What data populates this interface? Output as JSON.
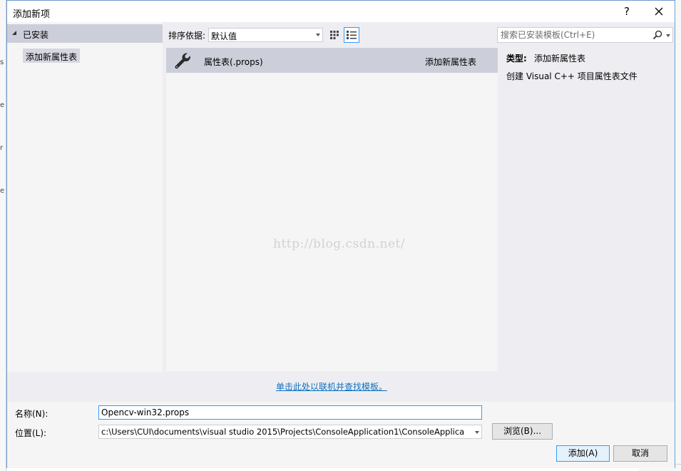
{
  "background": {
    "left_glyphs": [
      "s",
      "e",
      "r",
      "e"
    ]
  },
  "dialog": {
    "title": "添加新项",
    "help_label": "?",
    "close_icon": "close-icon"
  },
  "tree": {
    "header_label": "已安装",
    "items": [
      {
        "label": "添加新属性表",
        "selected": true
      }
    ]
  },
  "toolbar": {
    "sort_label": "排序依据:",
    "sort_value": "默认值",
    "view_icons": [
      "small-icons-view-icon",
      "list-view-icon"
    ]
  },
  "search": {
    "placeholder": "搜索已安装模板(Ctrl+E)"
  },
  "templates": [
    {
      "icon": "wrench-icon",
      "name": "属性表(.props)",
      "type": "添加新属性表",
      "selected": true
    }
  ],
  "watermark": "http://blog.csdn.net/",
  "details": {
    "type_label": "类型:",
    "type_value": "添加新属性表",
    "description": "创建 Visual C++ 项目属性表文件"
  },
  "online_link": "单击此处以联机并查找模板。",
  "form": {
    "name_label": "名称(N):",
    "name_value": "Opencv-win32.props",
    "location_label": "位置(L):",
    "location_value": "c:\\Users\\CUI\\documents\\visual studio 2015\\Projects\\ConsoleApplication1\\ConsoleApplica",
    "browse_label": "浏览(B)...",
    "add_label": "添加(A)",
    "cancel_label": "取消"
  },
  "colors": {
    "accent": "#3399ff",
    "selection": "#ccceda",
    "link": "#0e70c0",
    "dialog_bg": "#eeeef2"
  }
}
